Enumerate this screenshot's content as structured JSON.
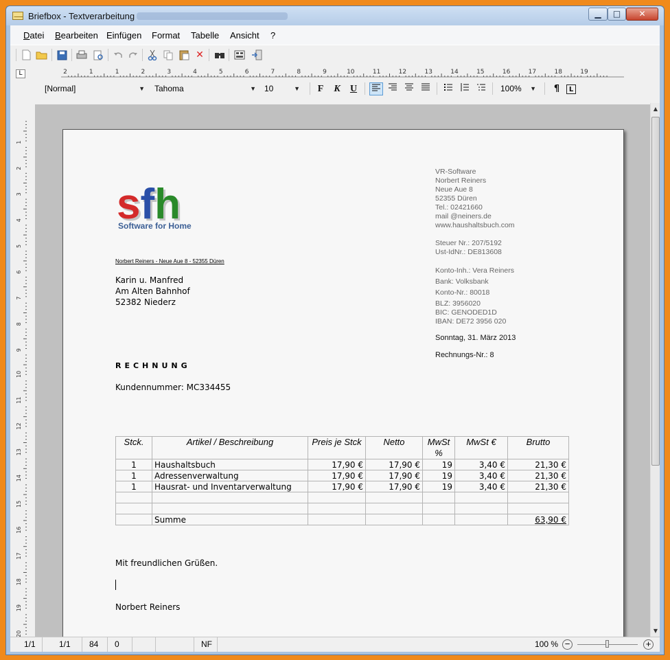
{
  "window": {
    "title": "Briefbox - Textverarbeitung",
    "minimize_glyph": "▁",
    "maximize_glyph": "□",
    "close_glyph": "✕"
  },
  "menu": [
    "Datei",
    "Bearbeiten",
    "Einfügen",
    "Format",
    "Tabelle",
    "Ansicht",
    "?"
  ],
  "toolbar": {
    "icons": [
      "new-document-icon",
      "open-folder-icon",
      "save-icon",
      "print-icon",
      "print-preview-icon",
      "undo-icon",
      "redo-icon",
      "cut-icon",
      "copy-icon",
      "paste-icon",
      "delete-icon",
      "find-icon",
      "fields-icon",
      "exit-icon"
    ]
  },
  "ruler": {
    "corner": "L",
    "labels": [
      "2",
      "1",
      "1",
      "2",
      "3",
      "4",
      "5",
      "6",
      "7",
      "8",
      "9",
      "10",
      "11",
      "12",
      "13",
      "14",
      "15",
      "16",
      "17",
      "18",
      "19"
    ]
  },
  "format_bar": {
    "style": "[Normal]",
    "font": "Tahoma",
    "size": "10",
    "bold": "F",
    "italic": "K",
    "underline": "U",
    "zoom": "100%",
    "pilcrow": "¶",
    "corner": "L"
  },
  "letter": {
    "logo_text": "sfh",
    "logo_tagline": "Software for Home",
    "sender_line": "Norbert Reiners - Neue Aue 8 - 52355 Düren",
    "recipient": [
      "Karin u. Manfred",
      "Am Alten Bahnhof",
      "52382 Niederz"
    ],
    "sender": [
      "VR-Software",
      "Norbert Reiners",
      "Neue Aue 8",
      "52355 Düren",
      "Tel.: 02421660",
      "mail @neiners.de",
      "www.haushaltsbuch.com"
    ],
    "tax": [
      "Steuer Nr.: 207/5192",
      "Ust-IdNr.: DE813608"
    ],
    "bank": [
      "Konto-Inh.: Vera Reiners",
      "Bank: Volksbank",
      "Konto-Nr.: 80018",
      "BLZ: 3956020",
      "BIC: GENODED1D",
      "IBAN: DE72 3956 020"
    ],
    "date": "Sonntag, 31. März 2013",
    "invoice_no": "Rechnungs-Nr.: 8",
    "title": "RECHNUNG",
    "customer_no": "Kundennummer: MC334455",
    "table": {
      "headers": [
        "Stck.",
        "Artikel / Beschreibung",
        "Preis je Stck",
        "Netto",
        "MwSt %",
        "MwSt €",
        "Brutto"
      ],
      "rows": [
        [
          "1",
          "Haushaltsbuch",
          "17,90 €",
          "17,90 €",
          "19",
          "3,40 €",
          "21,30 €"
        ],
        [
          "1",
          "Adressenverwaltung",
          "17,90 €",
          "17,90 €",
          "19",
          "3,40 €",
          "21,30 €"
        ],
        [
          "1",
          "Hausrat- und Inventarverwaltung",
          "17,90 €",
          "17,90 €",
          "19",
          "3,40 €",
          "21,30 €"
        ]
      ],
      "sum_label": "Summe",
      "sum_value": "63,90 €"
    },
    "closing": "Mit freundlichen Grüßen.",
    "signer": "Norbert Reiners"
  },
  "status": {
    "page": "1/1",
    "section": "1/1",
    "line": "84",
    "col": "0",
    "mode": "NF",
    "zoom": "100 %",
    "zoom_level": 0.5
  }
}
